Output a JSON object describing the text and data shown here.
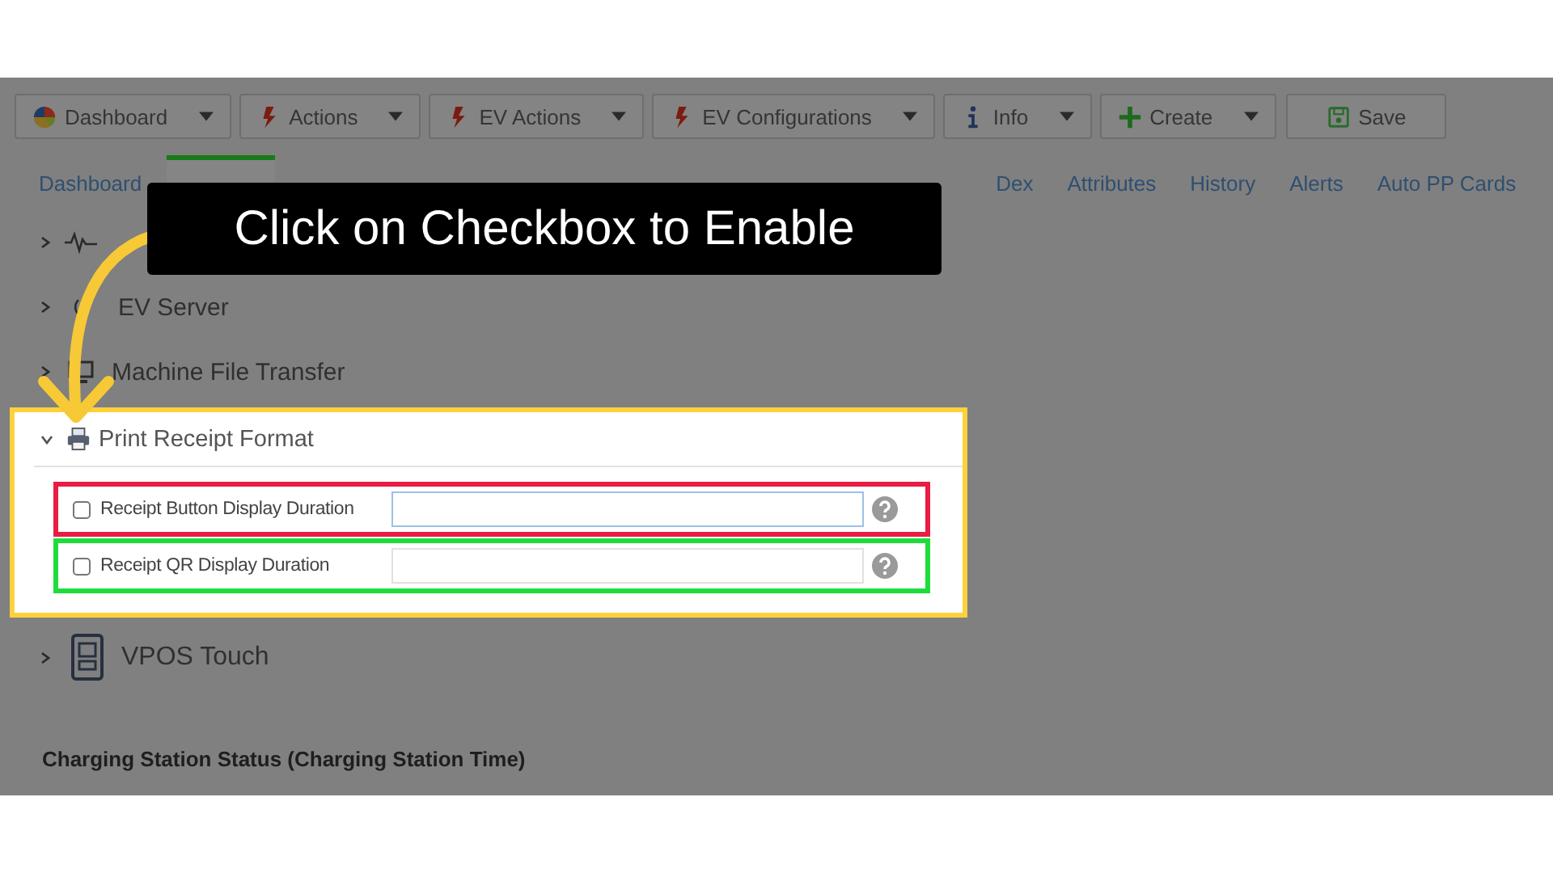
{
  "toolbar": [
    {
      "label": "Dashboard",
      "dropdown": true
    },
    {
      "label": "Actions",
      "dropdown": true
    },
    {
      "label": "EV Actions",
      "dropdown": true
    },
    {
      "label": "EV Configurations",
      "dropdown": true
    },
    {
      "label": "Info",
      "dropdown": true
    },
    {
      "label": "Create",
      "dropdown": true
    },
    {
      "label": "Save",
      "dropdown": false
    }
  ],
  "tabs": [
    {
      "label": "Dashboard",
      "selected": false
    },
    {
      "selected": true
    },
    {
      "label": "Dex",
      "selected": false
    },
    {
      "label": "Attributes",
      "selected": false
    },
    {
      "label": "History",
      "selected": false
    },
    {
      "label": "Alerts",
      "selected": false
    },
    {
      "label": "Auto PP Cards",
      "selected": false
    }
  ],
  "sections": [
    {
      "expanded": false
    },
    {
      "label": "EV Server",
      "expanded": false
    },
    {
      "label": "Machine File Transfer",
      "expanded": false
    },
    {
      "label": "Print Receipt Format",
      "expanded": true,
      "fields": [
        {
          "label": "Receipt Button Display Duration",
          "checked": false,
          "focused": true,
          "color": "#ea1c44"
        },
        {
          "label": "Receipt QR Display Duration",
          "checked": false,
          "focused": false,
          "color": "#1fdc3c"
        }
      ]
    },
    {
      "label": "VPOS Touch",
      "expanded": false
    }
  ],
  "heading": "Charging Station Status (Charging Station Time)",
  "callout": "Click on Checkbox to Enable"
}
